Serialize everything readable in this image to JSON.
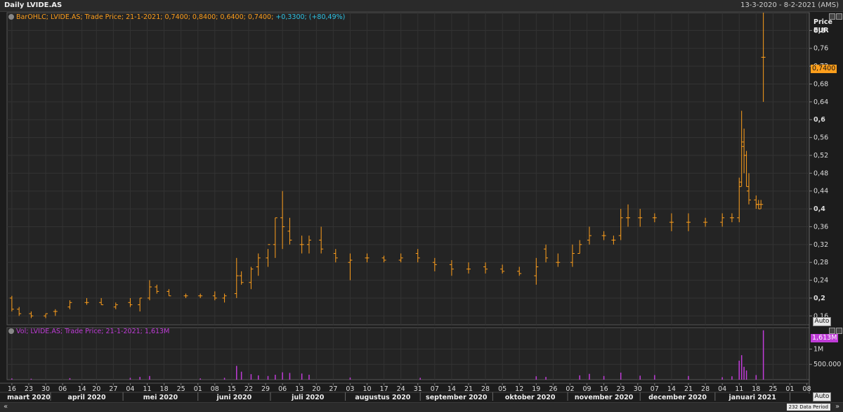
{
  "header": {
    "title": "Daily LVIDE.AS",
    "date_range": "13-3-2020 - 8-2-2021 (AMS)"
  },
  "price_panel": {
    "legend_main": "BarOHLC; LVIDE.AS; Trade Price; 21-1-2021; 0,7400; 0,8400; 0,6400; 0,7400;",
    "legend_change": "+0,3300; (+80,49%)",
    "unit_line1": "Price",
    "unit_line2": "EUR",
    "last_value": "0,7400",
    "auto_label": "Auto"
  },
  "volume_panel": {
    "legend": "Vol; LVIDE.AS; Trade Price; 21-1-2021; 1,613M",
    "last_value": "1,613M",
    "auto_label": "Auto"
  },
  "footer": {
    "scroll_left": "«",
    "scroll_right": "»",
    "data_period": "232 Data Period"
  },
  "colors": {
    "price_series": "#ff9f1c",
    "volume_series": "#c03cd8",
    "change_text": "#2ec4e6",
    "background": "#1c1c1c"
  },
  "chart_data": [
    {
      "type": "bar",
      "subtype": "ohlc",
      "series": [
        {
          "name": "BarOHLC; LVIDE.AS; Trade Price",
          "x": [
            "2020-03-16",
            "2020-03-19",
            "2020-03-24",
            "2020-03-30",
            "2020-04-03",
            "2020-04-09",
            "2020-04-16",
            "2020-04-22",
            "2020-04-28",
            "2020-05-04",
            "2020-05-08",
            "2020-05-12",
            "2020-05-15",
            "2020-05-20",
            "2020-05-27",
            "2020-06-02",
            "2020-06-08",
            "2020-06-12",
            "2020-06-17",
            "2020-06-19",
            "2020-06-23",
            "2020-06-26",
            "2020-06-30",
            "2020-07-03",
            "2020-07-06",
            "2020-07-09",
            "2020-07-14",
            "2020-07-17",
            "2020-07-22",
            "2020-07-28",
            "2020-08-03",
            "2020-08-10",
            "2020-08-17",
            "2020-08-24",
            "2020-08-31",
            "2020-09-07",
            "2020-09-14",
            "2020-09-21",
            "2020-09-28",
            "2020-10-05",
            "2020-10-12",
            "2020-10-19",
            "2020-10-23",
            "2020-10-28",
            "2020-11-03",
            "2020-11-06",
            "2020-11-10",
            "2020-11-16",
            "2020-11-20",
            "2020-11-23",
            "2020-11-26",
            "2020-12-01",
            "2020-12-07",
            "2020-12-14",
            "2020-12-21",
            "2020-12-28",
            "2021-01-04",
            "2021-01-08",
            "2021-01-11",
            "2021-01-12",
            "2021-01-13",
            "2021-01-14",
            "2021-01-15",
            "2021-01-18",
            "2021-01-19",
            "2021-01-20",
            "2021-01-21"
          ],
          "open": [
            0.2,
            0.175,
            0.165,
            0.16,
            0.17,
            0.18,
            0.19,
            0.19,
            0.18,
            0.19,
            0.185,
            0.2,
            0.225,
            0.215,
            0.205,
            0.205,
            0.205,
            0.2,
            0.21,
            0.25,
            0.235,
            0.27,
            0.29,
            0.32,
            0.38,
            0.35,
            0.32,
            0.32,
            0.33,
            0.3,
            0.28,
            0.29,
            0.29,
            0.285,
            0.3,
            0.28,
            0.275,
            0.265,
            0.27,
            0.265,
            0.26,
            0.25,
            0.31,
            0.28,
            0.28,
            0.3,
            0.33,
            0.34,
            0.33,
            0.34,
            0.38,
            0.38,
            0.38,
            0.37,
            0.37,
            0.37,
            0.37,
            0.38,
            0.38,
            0.46,
            0.54,
            0.52,
            0.44,
            0.42,
            0.41,
            0.41,
            0.74
          ],
          "high": [
            0.205,
            0.18,
            0.17,
            0.165,
            0.175,
            0.195,
            0.2,
            0.2,
            0.19,
            0.2,
            0.2,
            0.24,
            0.23,
            0.22,
            0.21,
            0.21,
            0.215,
            0.21,
            0.29,
            0.26,
            0.27,
            0.3,
            0.31,
            0.38,
            0.44,
            0.38,
            0.34,
            0.34,
            0.36,
            0.31,
            0.3,
            0.3,
            0.295,
            0.3,
            0.31,
            0.29,
            0.285,
            0.28,
            0.28,
            0.275,
            0.27,
            0.29,
            0.32,
            0.3,
            0.32,
            0.33,
            0.36,
            0.35,
            0.34,
            0.4,
            0.41,
            0.4,
            0.39,
            0.39,
            0.39,
            0.38,
            0.39,
            0.39,
            0.47,
            0.62,
            0.58,
            0.53,
            0.48,
            0.43,
            0.42,
            0.42,
            0.84
          ],
          "low": [
            0.17,
            0.16,
            0.155,
            0.155,
            0.16,
            0.175,
            0.185,
            0.185,
            0.175,
            0.18,
            0.17,
            0.195,
            0.21,
            0.205,
            0.2,
            0.2,
            0.195,
            0.19,
            0.2,
            0.23,
            0.22,
            0.25,
            0.27,
            0.29,
            0.31,
            0.32,
            0.3,
            0.3,
            0.3,
            0.28,
            0.24,
            0.28,
            0.28,
            0.28,
            0.28,
            0.26,
            0.25,
            0.255,
            0.255,
            0.255,
            0.25,
            0.23,
            0.28,
            0.27,
            0.27,
            0.3,
            0.32,
            0.33,
            0.32,
            0.33,
            0.36,
            0.36,
            0.37,
            0.35,
            0.35,
            0.36,
            0.36,
            0.37,
            0.37,
            0.45,
            0.48,
            0.45,
            0.41,
            0.4,
            0.4,
            0.4,
            0.64
          ],
          "close": [
            0.175,
            0.165,
            0.16,
            0.165,
            0.17,
            0.19,
            0.19,
            0.185,
            0.185,
            0.185,
            0.2,
            0.225,
            0.215,
            0.205,
            0.205,
            0.205,
            0.2,
            0.205,
            0.25,
            0.235,
            0.265,
            0.29,
            0.32,
            0.38,
            0.36,
            0.33,
            0.32,
            0.33,
            0.31,
            0.29,
            0.285,
            0.29,
            0.285,
            0.29,
            0.29,
            0.275,
            0.265,
            0.265,
            0.265,
            0.26,
            0.255,
            0.27,
            0.29,
            0.28,
            0.3,
            0.32,
            0.34,
            0.34,
            0.33,
            0.38,
            0.38,
            0.38,
            0.38,
            0.37,
            0.37,
            0.37,
            0.38,
            0.38,
            0.45,
            0.55,
            0.52,
            0.45,
            0.42,
            0.41,
            0.4,
            0.41,
            0.74
          ]
        }
      ],
      "ylim": [
        0.14,
        0.84
      ],
      "yticks": [
        "0,16",
        "0,2",
        "0,24",
        "0,28",
        "0,32",
        "0,36",
        "0,4",
        "0,44",
        "0,48",
        "0,52",
        "0,56",
        "0,6",
        "0,64",
        "0,68",
        "0,72",
        "0,76",
        "0,8"
      ],
      "ytick_values": [
        0.16,
        0.2,
        0.24,
        0.28,
        0.32,
        0.36,
        0.4,
        0.44,
        0.48,
        0.52,
        0.56,
        0.6,
        0.64,
        0.68,
        0.72,
        0.76,
        0.8
      ],
      "bold_ticks": [
        "0,2",
        "0,4",
        "0,6",
        "0,8"
      ],
      "ylabel": "Price EUR",
      "grid": true
    },
    {
      "type": "bar",
      "series": [
        {
          "name": "Vol; LVIDE.AS; Trade Price",
          "x": [
            "2020-03-16",
            "2020-03-24",
            "2020-04-09",
            "2020-05-04",
            "2020-05-08",
            "2020-05-12",
            "2020-06-02",
            "2020-06-12",
            "2020-06-17",
            "2020-06-19",
            "2020-06-23",
            "2020-06-26",
            "2020-06-30",
            "2020-07-03",
            "2020-07-06",
            "2020-07-09",
            "2020-07-14",
            "2020-07-17",
            "2020-08-03",
            "2020-09-01",
            "2020-10-19",
            "2020-10-23",
            "2020-11-06",
            "2020-11-10",
            "2020-11-16",
            "2020-11-23",
            "2020-12-01",
            "2020-12-07",
            "2020-12-21",
            "2021-01-04",
            "2021-01-08",
            "2021-01-11",
            "2021-01-12",
            "2021-01-13",
            "2021-01-14",
            "2021-01-18",
            "2021-01-21"
          ],
          "values": [
            40000,
            30000,
            50000,
            60000,
            90000,
            120000,
            40000,
            60000,
            450000,
            260000,
            180000,
            140000,
            120000,
            160000,
            240000,
            220000,
            200000,
            160000,
            70000,
            60000,
            110000,
            90000,
            140000,
            190000,
            120000,
            230000,
            130000,
            150000,
            120000,
            80000,
            110000,
            620000,
            800000,
            420000,
            300000,
            150000,
            1613000
          ]
        }
      ],
      "ylim": [
        0,
        1700000
      ],
      "yticks": [
        "500.000",
        "1M"
      ],
      "ytick_values": [
        500000,
        1000000
      ],
      "grid": true
    }
  ],
  "x_axis": {
    "start": "2020-03-14",
    "end": "2021-02-09",
    "day_ticks": [
      {
        "date": "2020-03-16",
        "label": "16"
      },
      {
        "date": "2020-03-23",
        "label": "23"
      },
      {
        "date": "2020-03-30",
        "label": "30"
      },
      {
        "date": "2020-04-06",
        "label": "06"
      },
      {
        "date": "2020-04-14",
        "label": "14"
      },
      {
        "date": "2020-04-20",
        "label": "20"
      },
      {
        "date": "2020-04-27",
        "label": "27"
      },
      {
        "date": "2020-05-04",
        "label": "04"
      },
      {
        "date": "2020-05-11",
        "label": "11"
      },
      {
        "date": "2020-05-18",
        "label": "18"
      },
      {
        "date": "2020-05-25",
        "label": "25"
      },
      {
        "date": "2020-06-01",
        "label": "01"
      },
      {
        "date": "2020-06-08",
        "label": "08"
      },
      {
        "date": "2020-06-15",
        "label": "15"
      },
      {
        "date": "2020-06-22",
        "label": "22"
      },
      {
        "date": "2020-06-29",
        "label": "29"
      },
      {
        "date": "2020-07-06",
        "label": "06"
      },
      {
        "date": "2020-07-13",
        "label": "13"
      },
      {
        "date": "2020-07-20",
        "label": "20"
      },
      {
        "date": "2020-07-27",
        "label": "27"
      },
      {
        "date": "2020-08-03",
        "label": "03"
      },
      {
        "date": "2020-08-10",
        "label": "10"
      },
      {
        "date": "2020-08-17",
        "label": "17"
      },
      {
        "date": "2020-08-24",
        "label": "24"
      },
      {
        "date": "2020-08-31",
        "label": "31"
      },
      {
        "date": "2020-09-07",
        "label": "07"
      },
      {
        "date": "2020-09-14",
        "label": "14"
      },
      {
        "date": "2020-09-21",
        "label": "21"
      },
      {
        "date": "2020-09-28",
        "label": "28"
      },
      {
        "date": "2020-10-05",
        "label": "05"
      },
      {
        "date": "2020-10-12",
        "label": "12"
      },
      {
        "date": "2020-10-19",
        "label": "19"
      },
      {
        "date": "2020-10-26",
        "label": "26"
      },
      {
        "date": "2020-11-02",
        "label": "02"
      },
      {
        "date": "2020-11-09",
        "label": "09"
      },
      {
        "date": "2020-11-16",
        "label": "16"
      },
      {
        "date": "2020-11-23",
        "label": "23"
      },
      {
        "date": "2020-11-30",
        "label": "30"
      },
      {
        "date": "2020-12-07",
        "label": "07"
      },
      {
        "date": "2020-12-14",
        "label": "14"
      },
      {
        "date": "2020-12-21",
        "label": "21"
      },
      {
        "date": "2020-12-28",
        "label": "28"
      },
      {
        "date": "2021-01-04",
        "label": "04"
      },
      {
        "date": "2021-01-11",
        "label": "11"
      },
      {
        "date": "2021-01-18",
        "label": "18"
      },
      {
        "date": "2021-01-25",
        "label": "25"
      },
      {
        "date": "2021-02-01",
        "label": "01"
      },
      {
        "date": "2021-02-08",
        "label": "08"
      }
    ],
    "months": [
      {
        "start": "2020-03-14",
        "end": "2020-04-01",
        "label": "maart 2020"
      },
      {
        "start": "2020-04-01",
        "end": "2020-05-01",
        "label": "april 2020"
      },
      {
        "start": "2020-05-01",
        "end": "2020-06-01",
        "label": "mei 2020"
      },
      {
        "start": "2020-06-01",
        "end": "2020-07-01",
        "label": "juni 2020"
      },
      {
        "start": "2020-07-01",
        "end": "2020-08-01",
        "label": "juli 2020"
      },
      {
        "start": "2020-08-01",
        "end": "2020-09-01",
        "label": "augustus 2020"
      },
      {
        "start": "2020-09-01",
        "end": "2020-10-01",
        "label": "september 2020"
      },
      {
        "start": "2020-10-01",
        "end": "2020-11-01",
        "label": "oktober 2020"
      },
      {
        "start": "2020-11-01",
        "end": "2020-12-01",
        "label": "november 2020"
      },
      {
        "start": "2020-12-01",
        "end": "2021-01-01",
        "label": "december 2020"
      },
      {
        "start": "2021-01-01",
        "end": "2021-02-01",
        "label": "januari 2021"
      }
    ]
  }
}
